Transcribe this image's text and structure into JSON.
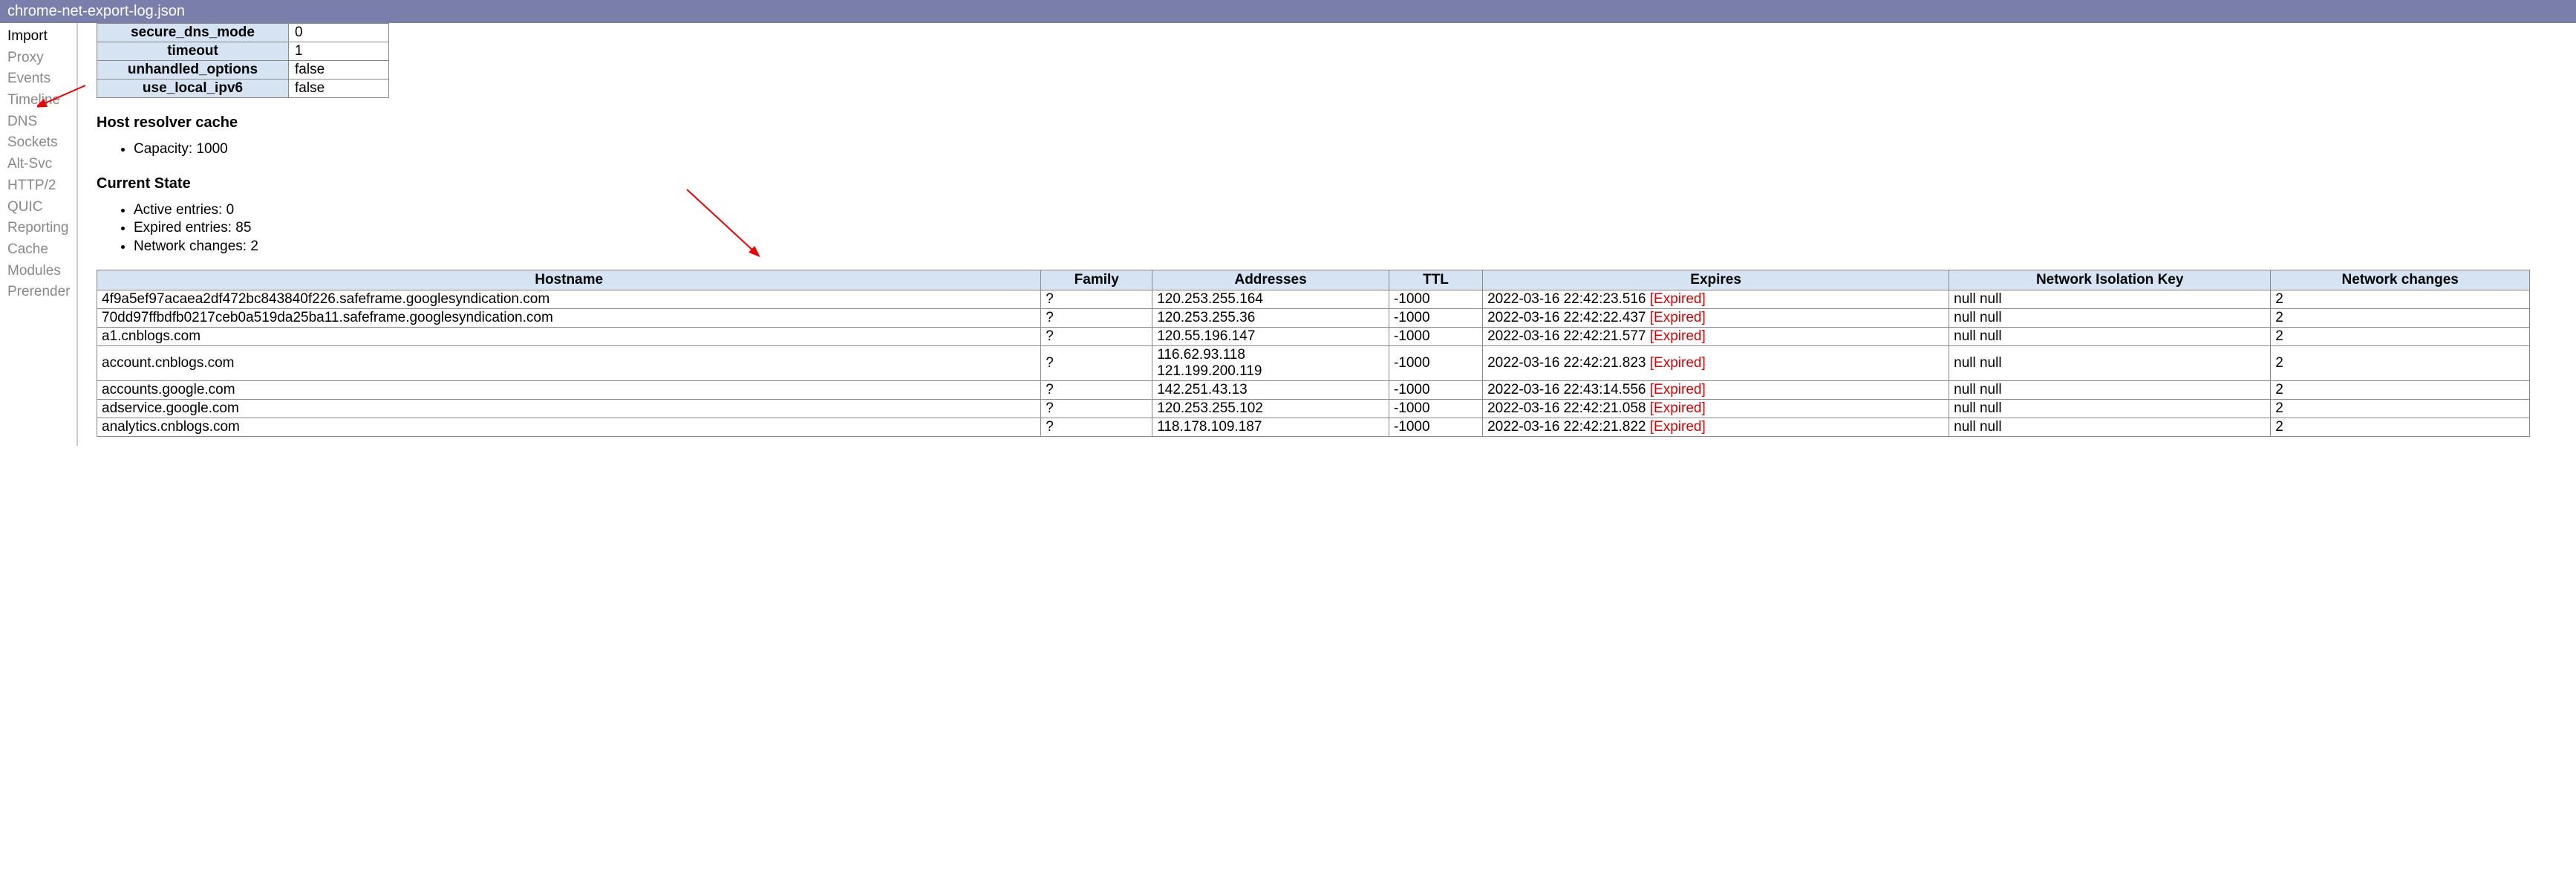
{
  "titlebar": "chrome-net-export-log.json",
  "sidebar": {
    "items": [
      {
        "label": "Import",
        "active": true
      },
      {
        "label": "Proxy",
        "active": false
      },
      {
        "label": "Events",
        "active": false
      },
      {
        "label": "Timeline",
        "active": false
      },
      {
        "label": "DNS",
        "active": false
      },
      {
        "label": "Sockets",
        "active": false
      },
      {
        "label": "Alt-Svc",
        "active": false
      },
      {
        "label": "HTTP/2",
        "active": false
      },
      {
        "label": "QUIC",
        "active": false
      },
      {
        "label": "Reporting",
        "active": false
      },
      {
        "label": "Cache",
        "active": false
      },
      {
        "label": "Modules",
        "active": false
      },
      {
        "label": "Prerender",
        "active": false
      }
    ]
  },
  "config_table": [
    {
      "key": "secure_dns_mode",
      "value": "0"
    },
    {
      "key": "timeout",
      "value": "1"
    },
    {
      "key": "unhandled_options",
      "value": "false"
    },
    {
      "key": "use_local_ipv6",
      "value": "false"
    }
  ],
  "headings": {
    "host_cache": "Host resolver cache",
    "current_state": "Current State"
  },
  "host_cache": {
    "capacity": "Capacity: 1000"
  },
  "state": {
    "active": "Active entries: 0",
    "expired": "Expired entries: 85",
    "changes": "Network changes: 2"
  },
  "cache_headers": {
    "hostname": "Hostname",
    "family": "Family",
    "addresses": "Addresses",
    "ttl": "TTL",
    "expires": "Expires",
    "nik": "Network Isolation Key",
    "changes": "Network changes"
  },
  "cache_rows": [
    {
      "hostname": "4f9a5ef97acaea2df472bc843840f226.safeframe.googlesyndication.com",
      "family": "?",
      "addresses": "120.253.255.164",
      "ttl": "-1000",
      "expires": "2022-03-16 22:42:23.516 ",
      "expired": "[Expired]",
      "nik": "null null",
      "changes": "2"
    },
    {
      "hostname": "70dd97ffbdfb0217ceb0a519da25ba11.safeframe.googlesyndication.com",
      "family": "?",
      "addresses": "120.253.255.36",
      "ttl": "-1000",
      "expires": "2022-03-16 22:42:22.437 ",
      "expired": "[Expired]",
      "nik": "null null",
      "changes": "2"
    },
    {
      "hostname": "a1.cnblogs.com",
      "family": "?",
      "addresses": "120.55.196.147",
      "ttl": "-1000",
      "expires": "2022-03-16 22:42:21.577 ",
      "expired": "[Expired]",
      "nik": "null null",
      "changes": "2"
    },
    {
      "hostname": "account.cnblogs.com",
      "family": "?",
      "addresses": "116.62.93.118\n121.199.200.119",
      "ttl": "-1000",
      "expires": "2022-03-16 22:42:21.823 ",
      "expired": "[Expired]",
      "nik": "null null",
      "changes": "2"
    },
    {
      "hostname": "accounts.google.com",
      "family": "?",
      "addresses": "142.251.43.13",
      "ttl": "-1000",
      "expires": "2022-03-16 22:43:14.556 ",
      "expired": "[Expired]",
      "nik": "null null",
      "changes": "2"
    },
    {
      "hostname": "adservice.google.com",
      "family": "?",
      "addresses": "120.253.255.102",
      "ttl": "-1000",
      "expires": "2022-03-16 22:42:21.058 ",
      "expired": "[Expired]",
      "nik": "null null",
      "changes": "2"
    },
    {
      "hostname": "analytics.cnblogs.com",
      "family": "?",
      "addresses": "118.178.109.187",
      "ttl": "-1000",
      "expires": "2022-03-16 22:42:21.822 ",
      "expired": "[Expired]",
      "nik": "null null",
      "changes": "2"
    }
  ]
}
